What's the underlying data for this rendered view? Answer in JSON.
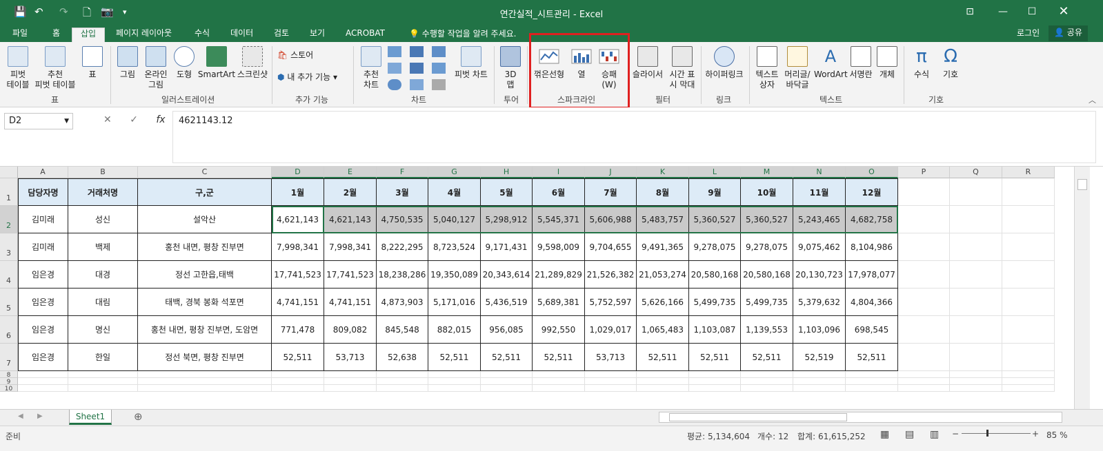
{
  "window": {
    "title": "연간실적_시트관리 - Excel",
    "quick_access": [
      "save-icon",
      "undo-icon",
      "redo-icon",
      "new-icon",
      "camera-icon",
      "customize-icon"
    ],
    "controls": [
      "ribbon-display-icon",
      "minimize-icon",
      "maximize-icon",
      "close-icon"
    ]
  },
  "tabs": {
    "items": [
      "파일",
      "홈",
      "삽입",
      "페이지 레이아웃",
      "수식",
      "데이터",
      "검토",
      "보기",
      "ACROBAT"
    ],
    "active": "삽입",
    "tell_me": "수행할 작업을 알려 주세요.",
    "login": "로그인",
    "share": "공유"
  },
  "ribbon": {
    "groups": {
      "table": "표",
      "illustrations": "일러스트레이션",
      "addins": "추가 기능",
      "charts": "차트",
      "tours": "투어",
      "sparklines": "스파크라인",
      "filters": "필터",
      "links": "링크",
      "text": "텍스트",
      "symbols": "기호"
    },
    "buttons": {
      "pivot": "피벗\n테이블",
      "rec_pivot": "추천\n피벗 테이블",
      "table": "표",
      "picture": "그림",
      "online_picture": "온라인\n그림",
      "shapes": "도형",
      "smartart": "SmartArt",
      "screenshot": "스크린샷",
      "store": "스토어",
      "my_addins": "내 추가 기능",
      "rec_charts": "추천\n차트",
      "pivot_chart": "피벗 차트",
      "map3d": "3D\n맵",
      "spark_line": "꺾은선형",
      "spark_column": "열",
      "spark_winloss": "승패\n(W)",
      "slicer": "슬라이서",
      "timeline": "시간 표\n시 막대",
      "hyperlink": "하이퍼링크",
      "textbox": "텍스트\n상자",
      "header_footer": "머리글/\n바닥글",
      "wordart": "WordArt",
      "signature": "서명란",
      "object": "개체",
      "equation": "수식",
      "symbol": "기호"
    }
  },
  "formula_bar": {
    "name_box": "D2",
    "content": "4621143.12"
  },
  "grid": {
    "columns": [
      "A",
      "B",
      "C",
      "D",
      "E",
      "F",
      "G",
      "H",
      "I",
      "J",
      "K",
      "L",
      "M",
      "N",
      "O",
      "P",
      "Q",
      "R"
    ],
    "rows": [
      "1",
      "2",
      "3",
      "4",
      "5",
      "6",
      "7",
      "8",
      "9",
      "10"
    ],
    "headers": [
      "담당자명",
      "거래처명",
      "구,군",
      "1월",
      "2월",
      "3월",
      "4월",
      "5월",
      "6월",
      "7월",
      "8월",
      "9월",
      "10월",
      "11월",
      "12월"
    ],
    "data": [
      [
        "김미래",
        "성신",
        "설악산",
        "4,621,143",
        "4,621,143",
        "4,750,535",
        "5,040,127",
        "5,298,912",
        "5,545,371",
        "5,606,988",
        "5,483,757",
        "5,360,527",
        "5,360,527",
        "5,243,465",
        "4,682,758"
      ],
      [
        "김미래",
        "백제",
        "홍천 내면, 평창 진부면",
        "7,998,341",
        "7,998,341",
        "8,222,295",
        "8,723,524",
        "9,171,431",
        "9,598,009",
        "9,704,655",
        "9,491,365",
        "9,278,075",
        "9,278,075",
        "9,075,462",
        "8,104,986"
      ],
      [
        "임은경",
        "대경",
        "정선 고한읍,태백",
        "17,741,523",
        "17,741,523",
        "18,238,286",
        "19,350,089",
        "20,343,614",
        "21,289,829",
        "21,526,382",
        "21,053,274",
        "20,580,168",
        "20,580,168",
        "20,130,723",
        "17,978,077"
      ],
      [
        "임은경",
        "대림",
        "태백, 경북 봉화 석포면",
        "4,741,151",
        "4,741,151",
        "4,873,903",
        "5,171,016",
        "5,436,519",
        "5,689,381",
        "5,752,597",
        "5,626,166",
        "5,499,735",
        "5,499,735",
        "5,379,632",
        "4,804,366"
      ],
      [
        "임은경",
        "명신",
        "홍천 내면, 평창 진부면, 도암면",
        "771,478",
        "809,082",
        "845,548",
        "882,015",
        "956,085",
        "992,550",
        "1,029,017",
        "1,065,483",
        "1,103,087",
        "1,139,553",
        "1,103,096",
        "698,545"
      ],
      [
        "임은경",
        "한일",
        "정선 북면, 평창 진부면",
        "52,511",
        "53,713",
        "52,638",
        "52,511",
        "52,511",
        "52,511",
        "53,713",
        "52,511",
        "52,511",
        "52,511",
        "52,519",
        "52,511"
      ]
    ]
  },
  "sheet": {
    "tab": "Sheet1"
  },
  "status": {
    "ready": "준비",
    "average": "평균: 5,134,604",
    "count": "개수: 12",
    "sum": "합계: 61,615,252",
    "zoom": "85 %"
  }
}
